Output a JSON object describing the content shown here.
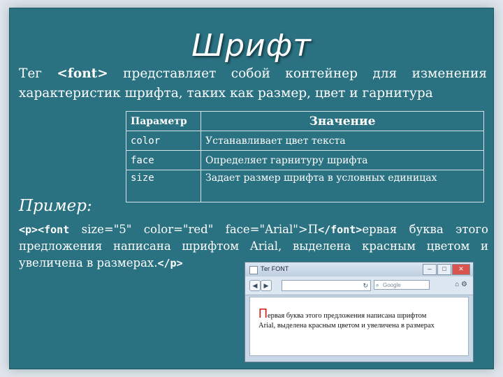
{
  "slide": {
    "title": "Шрифт",
    "intro": {
      "line1_a": "Тег ",
      "line1_tag": "<font>",
      "line1_b": " представляет собой контейнер для изменения",
      "line2": "характеристик шрифта, таких как размер, цвет и гарнитура"
    },
    "table": {
      "header": [
        "Параметр",
        "Значение"
      ],
      "rows": [
        {
          "param": "color",
          "value": "Устанавливает цвет текста"
        },
        {
          "param": "face",
          "value": "Определяет гарнитуру шрифта"
        },
        {
          "param": "size",
          "value": "Задает размер шрифта в условных единицах"
        }
      ]
    },
    "example_label": "Пример:",
    "example": {
      "line1_tag1": "<p><font",
      "line1_attrs": " size=\"5\" color=\"red\" face=\"Arial\">П",
      "line1_tag2": "</font>",
      "line1_rest": "ервая буква этого",
      "line2": "предложения написана шрифтом Arial, выделена красным цветом и",
      "line3_text": "увеличена в размерах.",
      "line3_tag": "</p>"
    },
    "browser": {
      "window_title": "Тег FONT",
      "search_placeholder": "Google",
      "first_letter": "П",
      "content_line1": "ервая буква этого предложения написана шрифтом",
      "content_line2": "Arial, выделена красным цветом и увеличена в размерах"
    }
  },
  "colors": {
    "slide_background": "#2a7181",
    "text": "#ffffff",
    "first_letter": "#d11a1a"
  }
}
